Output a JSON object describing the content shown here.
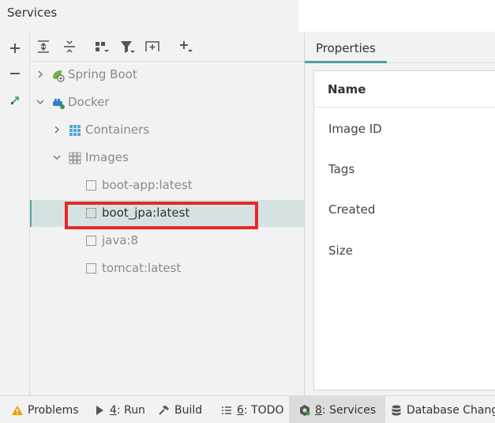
{
  "window": {
    "title": "Services"
  },
  "left_toolbar": {
    "add": "+",
    "remove": "−"
  },
  "tree": {
    "spring_boot": "Spring Boot",
    "docker": "Docker",
    "containers": "Containers",
    "images": "Images",
    "image_items": [
      "boot-app:latest",
      "boot_jpa:latest",
      "java:8",
      "tomcat:latest"
    ],
    "selected_index": 1
  },
  "properties": {
    "tab": "Properties",
    "header": "Name",
    "rows": [
      "Image ID",
      "Tags",
      "Created",
      "Size"
    ]
  },
  "statusbar": {
    "problems": "Problems",
    "run_num": "4",
    "run": ": Run",
    "build": "Build",
    "todo_num": "6",
    "todo": ": TODO",
    "services_num": "8",
    "services": ": Services",
    "db_changes": "Database Changes"
  },
  "colors": {
    "selection": "#d4e3e2",
    "accent": "#4f9ea3",
    "highlight_box": "#e8272c"
  }
}
